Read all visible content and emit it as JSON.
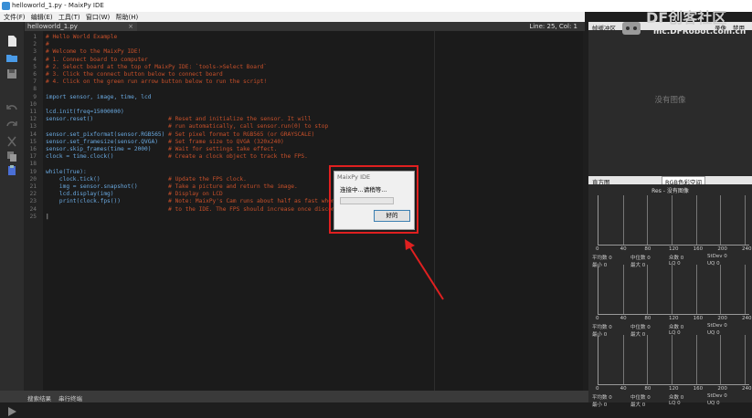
{
  "window": {
    "title": "helloworld_1.py - MaixPy IDE"
  },
  "menu": [
    "文件(F)",
    "编辑(E)",
    "工具(T)",
    "窗口(W)",
    "帮助(H)"
  ],
  "tab": {
    "label": "helloworld_1.py",
    "close": "×",
    "position": "Line: 25, Col: 1"
  },
  "editor": {
    "lines": [
      {
        "n": "1",
        "segs": [
          [
            "c",
            "# Hello World Example"
          ]
        ]
      },
      {
        "n": "2",
        "segs": [
          [
            "c",
            "#"
          ]
        ]
      },
      {
        "n": "3",
        "segs": [
          [
            "c",
            "# Welcome to the MaixPy IDE!"
          ]
        ]
      },
      {
        "n": "4",
        "segs": [
          [
            "c",
            "# 1. Connect board to computer"
          ]
        ]
      },
      {
        "n": "5",
        "segs": [
          [
            "c",
            "# 2. Select board at the top of MaixPy IDE: `tools->Select Board`"
          ]
        ]
      },
      {
        "n": "6",
        "segs": [
          [
            "c",
            "# 3. Click the connect button below to connect board"
          ]
        ]
      },
      {
        "n": "7",
        "segs": [
          [
            "c",
            "# 4. Click on the green run arrow button below to run the script!"
          ]
        ]
      },
      {
        "n": "8",
        "segs": []
      },
      {
        "n": "9",
        "segs": [
          [
            "k",
            "import sensor, image, time, lcd"
          ]
        ]
      },
      {
        "n": "10",
        "segs": []
      },
      {
        "n": "11",
        "segs": [
          [
            "k",
            "lcd.init(freq=15000000)"
          ]
        ]
      },
      {
        "n": "12",
        "segs": [
          [
            "k",
            "sensor.reset()"
          ],
          [
            "w",
            "                      "
          ],
          [
            "c",
            "# Reset and initialize the sensor. It will"
          ]
        ]
      },
      {
        "n": "13",
        "segs": [
          [
            "w",
            "                                    "
          ],
          [
            "c",
            "# run automatically, call sensor.run(0) to stop"
          ]
        ]
      },
      {
        "n": "14",
        "segs": [
          [
            "k",
            "sensor.set_pixformat(sensor.RGB565)"
          ],
          [
            "w",
            " "
          ],
          [
            "c",
            "# Set pixel format to RGB565 (or GRAYSCALE)"
          ]
        ]
      },
      {
        "n": "15",
        "segs": [
          [
            "k",
            "sensor.set_framesize(sensor.QVGA)"
          ],
          [
            "w",
            "   "
          ],
          [
            "c",
            "# Set frame size to QVGA (320x240)"
          ]
        ]
      },
      {
        "n": "16",
        "segs": [
          [
            "k",
            "sensor.skip_frames(time = 2000)"
          ],
          [
            "w",
            "     "
          ],
          [
            "c",
            "# Wait for settings take effect."
          ]
        ]
      },
      {
        "n": "17",
        "segs": [
          [
            "k",
            "clock = time.clock()"
          ],
          [
            "w",
            "                "
          ],
          [
            "c",
            "# Create a clock object to track the FPS."
          ]
        ]
      },
      {
        "n": "18",
        "segs": []
      },
      {
        "n": "19",
        "segs": [
          [
            "k",
            "while(True):"
          ]
        ]
      },
      {
        "n": "20",
        "segs": [
          [
            "k",
            "    clock.tick()"
          ],
          [
            "w",
            "                    "
          ],
          [
            "c",
            "# Update the FPS clock."
          ]
        ]
      },
      {
        "n": "21",
        "segs": [
          [
            "k",
            "    img = sensor.snapshot()"
          ],
          [
            "w",
            "         "
          ],
          [
            "c",
            "# Take a picture and return the image."
          ]
        ]
      },
      {
        "n": "22",
        "segs": [
          [
            "k",
            "    lcd.display(img)"
          ],
          [
            "w",
            "                "
          ],
          [
            "c",
            "# Display on LCD"
          ]
        ]
      },
      {
        "n": "23",
        "segs": [
          [
            "k",
            "    print(clock.fps())"
          ],
          [
            "w",
            "              "
          ],
          [
            "c",
            "# Note: MaixPy's Cam runs about half as fast when connected"
          ]
        ]
      },
      {
        "n": "24",
        "segs": [
          [
            "w",
            "                                    "
          ],
          [
            "c",
            "# to the IDE. The FPS should increase once disconnected."
          ]
        ]
      },
      {
        "n": "25",
        "segs": [
          [
            "w",
            "|"
          ]
        ]
      }
    ]
  },
  "frame_buffer": {
    "title": "帧缓冲区",
    "options": [
      "录像",
      "禁用"
    ],
    "no_image": "没有图像"
  },
  "histogram": {
    "title": "直方图",
    "colorspace": "RGB色彩空间",
    "res": "Res - 没有图像",
    "ticks": [
      "0",
      "40",
      "80",
      "120",
      "160",
      "200",
      "240"
    ],
    "stats": [
      [
        "平均数 0",
        "中位数 0",
        "众数 0",
        "StDev 0"
      ],
      [
        "最小 0",
        "最大 0",
        "LQ 0",
        "UQ 0"
      ]
    ]
  },
  "status": {
    "search": "搜索结果",
    "terminal": "串行终端"
  },
  "dialog": {
    "title": "MaixPy IDE",
    "message": "连接中...请稍等...",
    "button": "好的",
    "progress": 0
  },
  "watermark": {
    "brand": "DF创客社区",
    "url": "mc.DFRobot.com.cn"
  },
  "colors": {
    "accent": "#e02020",
    "comment": "#c8502a",
    "keyword": "#6aa9e0"
  }
}
